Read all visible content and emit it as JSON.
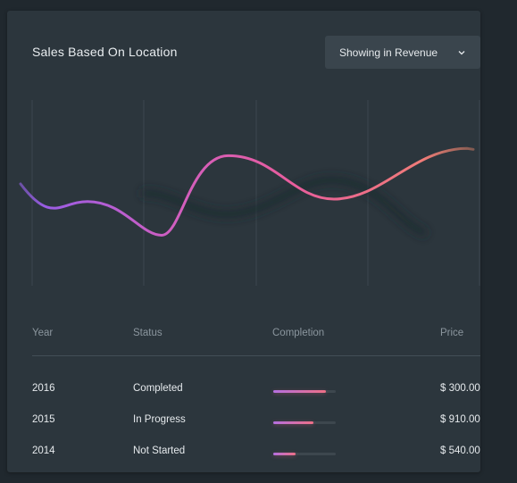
{
  "card": {
    "title": "Sales Based On Location",
    "dropdown": {
      "selected": "Showing in Revenue",
      "icon": "chevron-down-icon"
    }
  },
  "chart_data": {
    "type": "line",
    "grid": "vertical lines only",
    "x_count": 5,
    "series": [
      {
        "values": [
          38,
          10,
          76,
          40,
          82
        ]
      }
    ],
    "colors": {
      "start": "#9b5de5",
      "middle": "#e85d9d",
      "end": "#f28c6a"
    }
  },
  "table": {
    "headers": [
      "Year",
      "Status",
      "Completion",
      "Price"
    ],
    "rows": [
      {
        "year": "2016",
        "status": "Completed",
        "completion": 0.84,
        "price": "$ 300.00"
      },
      {
        "year": "2015",
        "status": "In Progress",
        "completion": 0.64,
        "price": "$ 910.00"
      },
      {
        "year": "2014",
        "status": "Not Started",
        "completion": 0.35,
        "price": "$ 540.00"
      }
    ]
  }
}
